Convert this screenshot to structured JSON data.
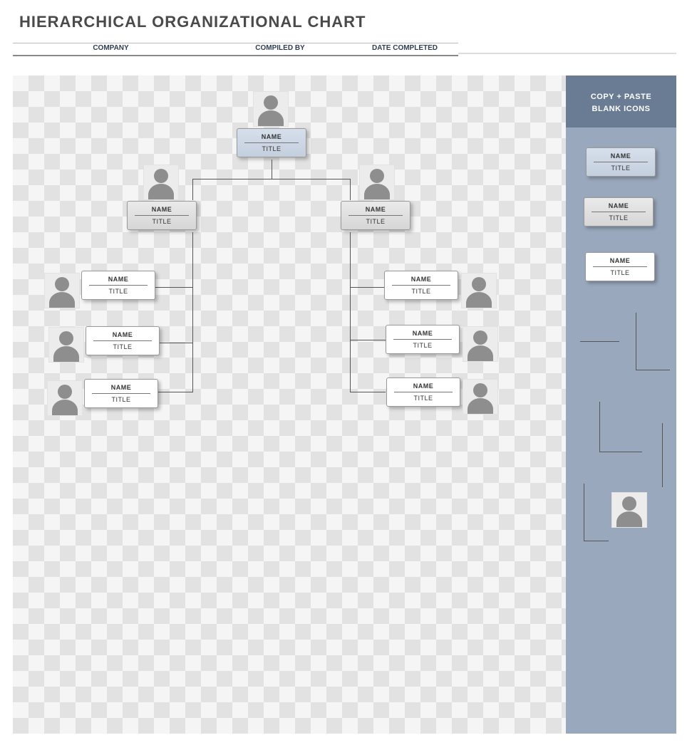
{
  "header": {
    "title": "HIERARCHICAL ORGANIZATIONAL CHART",
    "meta": {
      "company_label": "COMPANY",
      "compiled_by_label": "COMPILED BY",
      "date_completed_label": "DATE COMPLETED"
    }
  },
  "sidebar": {
    "heading_line1": "COPY + PASTE",
    "heading_line2": "BLANK ICONS",
    "templates": {
      "blue_card": {
        "name": "NAME",
        "title": "TITLE"
      },
      "gray_card": {
        "name": "NAME",
        "title": "TITLE"
      },
      "white_card": {
        "name": "NAME",
        "title": "TITLE"
      }
    }
  },
  "org": {
    "root": {
      "name": "NAME",
      "title": "TITLE"
    },
    "left": {
      "name": "NAME",
      "title": "TITLE"
    },
    "right": {
      "name": "NAME",
      "title": "TITLE"
    },
    "left_children": [
      {
        "name": "NAME",
        "title": "TITLE"
      },
      {
        "name": "NAME",
        "title": "TITLE"
      },
      {
        "name": "NAME",
        "title": "TITLE"
      }
    ],
    "right_children": [
      {
        "name": "NAME",
        "title": "TITLE"
      },
      {
        "name": "NAME",
        "title": "TITLE"
      },
      {
        "name": "NAME",
        "title": "TITLE"
      }
    ]
  }
}
